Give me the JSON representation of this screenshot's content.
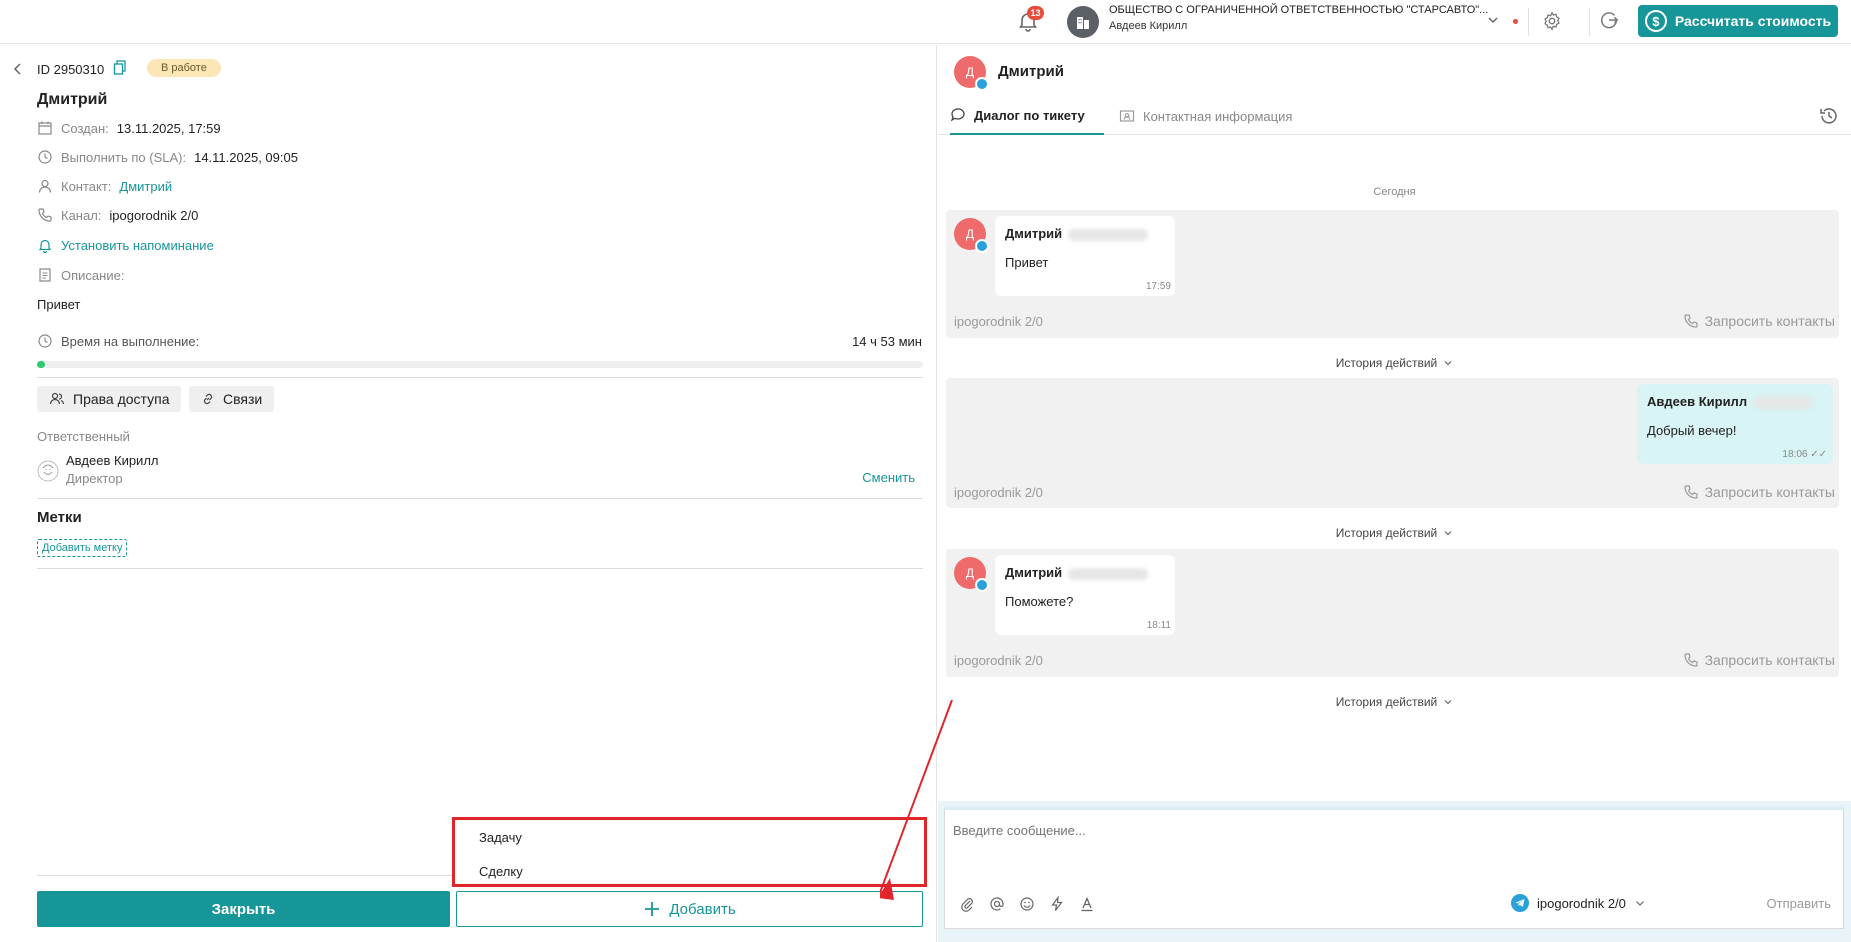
{
  "header": {
    "notifications_count": "13",
    "org_name": "ОБЩЕСТВО С ОГРАНИЧЕННОЙ ОТВЕТСТВЕННОСТЬЮ \"СТАРСАВТО\"...",
    "org_user": "Авдеев Кирилл",
    "calc_button": "Рассчитать стоимость",
    "calc_icon": "$"
  },
  "ticket": {
    "id": "ID 2950310",
    "status": "В работе",
    "title": "Дмитрий",
    "created_label": "Создан:",
    "created_value": "13.11.2025, 17:59",
    "sla_label": "Выполнить по (SLA):",
    "sla_value": "14.11.2025, 09:05",
    "contact_label": "Контакт:",
    "contact_value": "Дмитрий",
    "channel_label": "Канал:",
    "channel_value": "ipogorodnik 2/0",
    "reminder": "Установить напоминание",
    "description_label": "Описание:",
    "description_value": "Привет",
    "time_label": "Время на выполнение:",
    "time_value": "14 ч 53 мин",
    "progress_fraction": 0.008,
    "access_button": "Права доступа",
    "links_button": "Связи",
    "responsible_label": "Ответственный",
    "responsible_name": "Авдеев Кирилл",
    "responsible_role": "Директор",
    "change_link": "Сменить",
    "tags_title": "Метки",
    "add_tag": "Добавить метку",
    "close_button": "Закрыть",
    "add_button": "Добавить",
    "add_menu": [
      "Задачу",
      "Сделку"
    ]
  },
  "chat": {
    "contact_initial": "Д",
    "contact_name": "Дмитрий",
    "tab_dialog": "Диалог по тикету",
    "tab_contact": "Контактная информация",
    "date_separator": "Сегодня",
    "history_label": "История действий",
    "request_contacts": "Запросить контакты",
    "messages": [
      {
        "author": "Дмитрий",
        "text": "Привет",
        "time": "17:59",
        "channel": "ipogorodnik 2/0"
      },
      {
        "author": "Авдеев Кирилл",
        "text": "Добрый вечер!",
        "time": "18:06",
        "channel": "ipogorodnik 2/0"
      },
      {
        "author": "Дмитрий",
        "text": "Поможете?",
        "time": "18:11",
        "channel": "ipogorodnik 2/0"
      }
    ],
    "input_placeholder": "Введите сообщение...",
    "send_channel": "ipogorodnik 2/0",
    "send_button": "Отправить"
  },
  "colors": {
    "accent": "#17969a",
    "status_bg": "#fbe7b5",
    "highlight": "#e0252b",
    "avatar": "#ef6b6b"
  }
}
